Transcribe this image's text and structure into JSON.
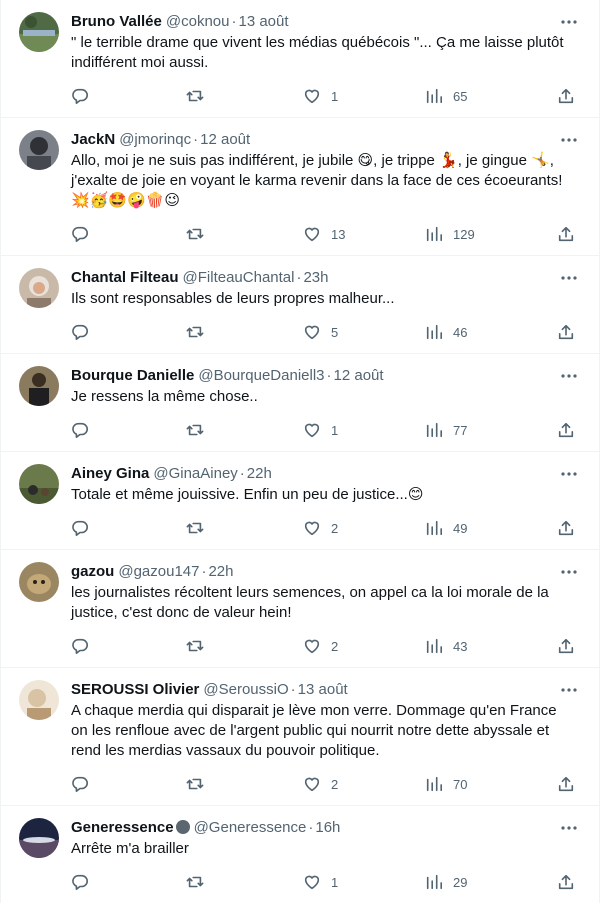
{
  "tweets": [
    {
      "name": "Bruno Vallée",
      "handle": "@coknou",
      "date": "13 août",
      "text_lines": [
        "\" le terrible drame que vivent les médias québécois \"... Ça me laisse plutôt",
        "indifférent moi aussi."
      ],
      "likes": "1",
      "views": "65"
    },
    {
      "name": "JackN",
      "handle": "@jmorinqc",
      "date": "12 août",
      "text_lines": [
        "Allo, moi je ne suis pas indifférent, je jubile 😋, je trippe 💃, je gingue 🤸, ",
        "j'exalte de joie en voyant le karma revenir dans la face de ces écoeurants!",
        "💥🥳🤩🤪🍿😉"
      ],
      "likes": "13",
      "views": "129"
    },
    {
      "name": "Chantal Filteau",
      "handle": "@FilteauChantal",
      "date": "23h",
      "text_lines": [
        "Ils sont responsables de leurs propres malheur..."
      ],
      "likes": "5",
      "views": "46"
    },
    {
      "name": "Bourque Danielle",
      "handle": "@BourqueDaniell3",
      "date": "12 août",
      "text_lines": [
        "Je ressens la même chose.."
      ],
      "likes": "1",
      "views": "77"
    },
    {
      "name": "Ainey Gina",
      "handle": "@GinaAiney",
      "date": "22h",
      "text_lines": [
        "Totale et même jouissive. Enfin un peu de justice...😊"
      ],
      "likes": "2",
      "views": "49"
    },
    {
      "name": "gazou",
      "handle": "@gazou147",
      "date": "22h",
      "text_lines": [
        "les journalistes récoltent leurs semences, on appel ca la loi morale de la",
        "justice, c'est donc de valeur hein!"
      ],
      "likes": "2",
      "views": "43"
    },
    {
      "name": "SEROUSSI Olivier",
      "handle": "@SeroussiO",
      "date": "13 août",
      "text_lines": [
        "A chaque merdia qui disparait je lève mon verre. Dommage qu'en France",
        "on les renfloue avec de l'argent public qui nourrit notre dette abyssale et",
        "rend les merdias vassaux du pouvoir politique."
      ],
      "likes": "2",
      "views": "70"
    },
    {
      "name": "Generessence",
      "handle": "@Generessence",
      "date": "16h",
      "text_lines": [
        "Arrête m'a brailler"
      ],
      "likes": "1",
      "views": "29"
    }
  ],
  "icons": {
    "reply": "reply-icon",
    "retweet": "retweet-icon",
    "like": "heart-icon",
    "views": "views-icon",
    "share": "share-icon",
    "more": "more-icon"
  },
  "colors": {
    "text": "#0f1419",
    "muted": "#536471",
    "divider": "#eff3f4"
  }
}
